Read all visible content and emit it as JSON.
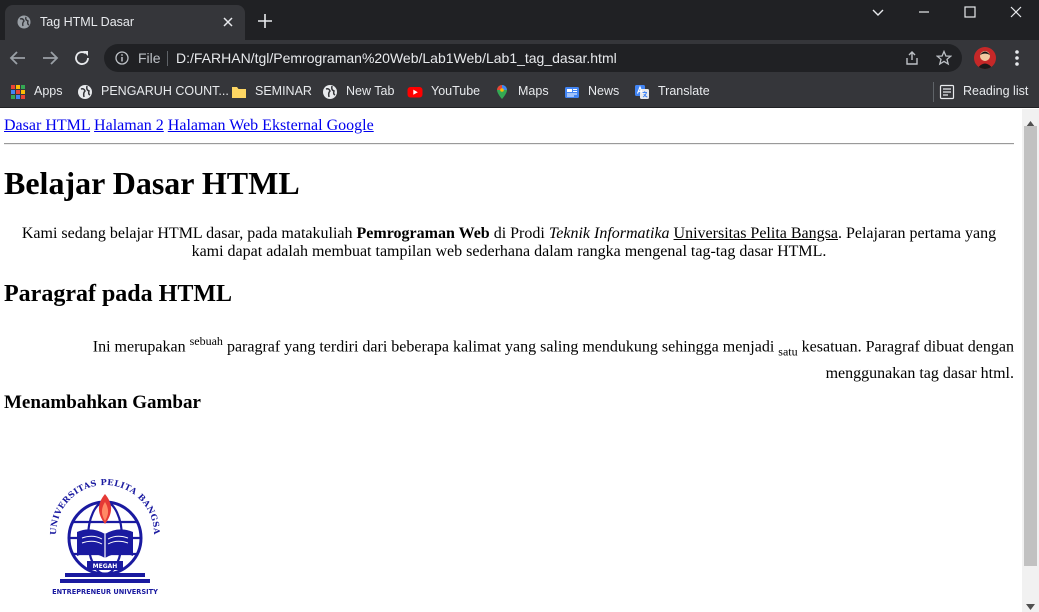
{
  "browser": {
    "tab_title": "Tag HTML Dasar",
    "address": {
      "scheme": "File",
      "url": "D:/FARHAN/tgl/Pemrograman%20Web/Lab1Web/Lab1_tag_dasar.html"
    },
    "bookmarks": [
      {
        "label": "Apps",
        "icon": "apps-grid-icon"
      },
      {
        "label": "PENGARUH COUNT...",
        "icon": "globe-icon"
      },
      {
        "label": "SEMINAR",
        "icon": "folder-icon"
      },
      {
        "label": "New Tab",
        "icon": "globe-icon"
      },
      {
        "label": "YouTube",
        "icon": "youtube-icon"
      },
      {
        "label": "Maps",
        "icon": "maps-pin-icon"
      },
      {
        "label": "News",
        "icon": "news-icon"
      },
      {
        "label": "Translate",
        "icon": "translate-icon"
      }
    ],
    "reading_list": "Reading list",
    "colors": {
      "tabstrip": "#202124",
      "toolbar": "#35363a",
      "link": "#0000ee"
    }
  },
  "page": {
    "nav_links": [
      "Dasar HTML",
      "Halaman 2",
      "Halaman Web Eksternal Google"
    ],
    "h1": "Belajar Dasar HTML",
    "intro": {
      "t1": "Kami sedang belajar HTML dasar, pada matakuliah ",
      "bold": "Pemrograman Web",
      "t2": " di Prodi ",
      "italic": "Teknik Informatika",
      "t3": " ",
      "underline": "Universitas Pelita Bangsa",
      "t4": ". Pelajaran pertama yang kami dapat adalah membuat tampilan web sederhana dalam rangka mengenal tag-tag dasar HTML."
    },
    "h2": "Paragraf pada HTML",
    "para": {
      "t1": "Ini merupakan ",
      "sup": "sebuah",
      "t2": " paragraf yang terdiri dari beberapa kalimat yang saling mendukung sehingga menjadi ",
      "sub": "satu",
      "t3": " kesatuan. Paragraf dibuat dengan menggunakan tag dasar html."
    },
    "h3": "Menambahkan Gambar",
    "logo": {
      "top_text": "UNIVERSITAS PELITA BANGSA",
      "center_text": "MEGAH",
      "bottom_text": "ENTREPRENEUR UNIVERSITY",
      "color": "#1a1aa0",
      "flame": "#e53935"
    }
  }
}
